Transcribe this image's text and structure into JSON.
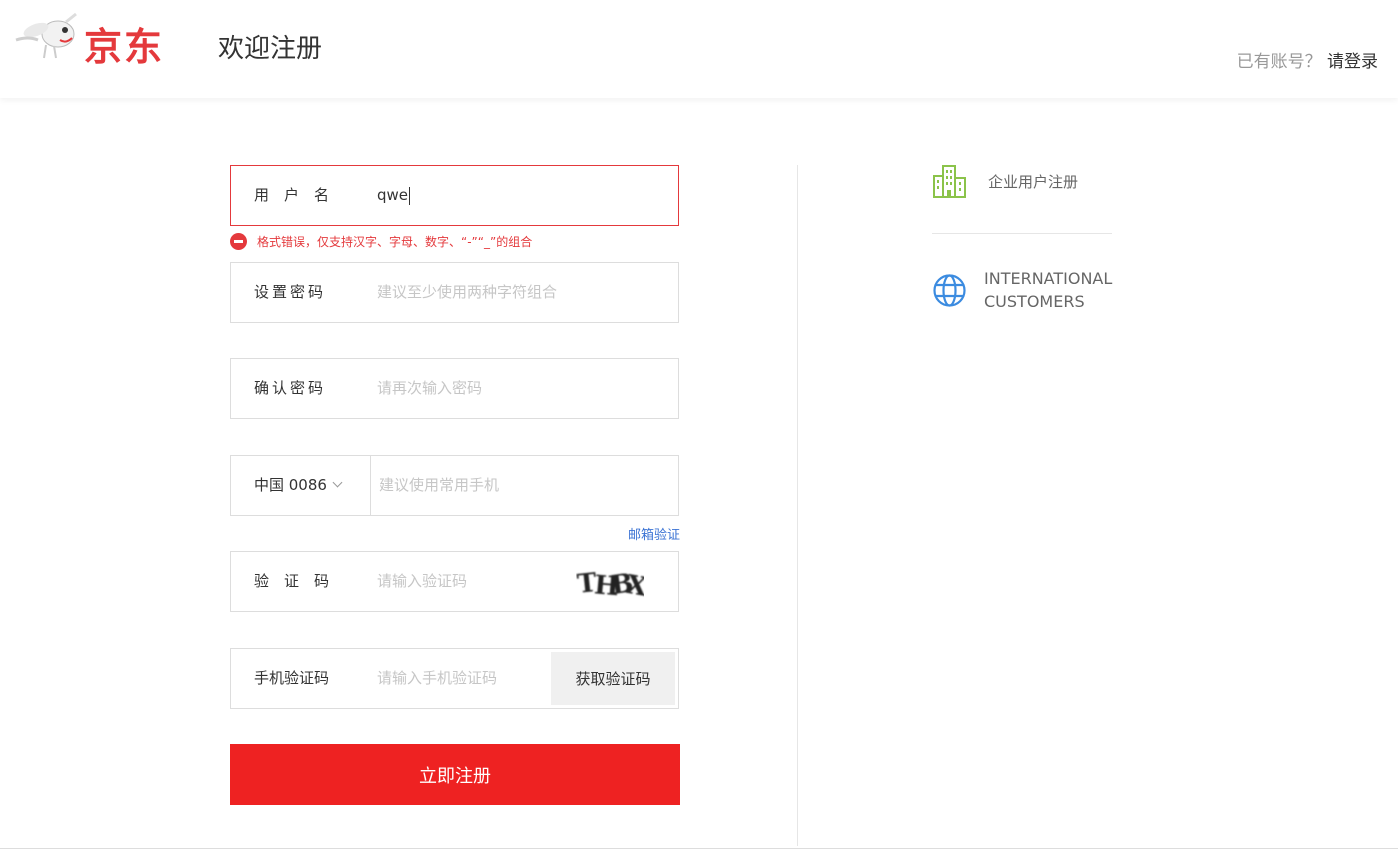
{
  "header": {
    "logo_text": "京东",
    "page_title": "欢迎注册",
    "login_question": "已有账号？",
    "login_link": "请登录"
  },
  "form": {
    "username": {
      "label": "用　户　名",
      "value": "qwe"
    },
    "error_message": "格式错误，仅支持汉字、字母、数字、“-”“_”的组合",
    "password": {
      "label": "设置密码",
      "placeholder": "建议至少使用两种字符组合"
    },
    "confirm_password": {
      "label": "确认密码",
      "placeholder": "请再次输入密码"
    },
    "phone": {
      "country": "中国 0086",
      "placeholder": "建议使用常用手机"
    },
    "email_verify_link": "邮箱验证",
    "captcha": {
      "label": "验　证　码",
      "placeholder": "请输入验证码",
      "image_text": "THBX"
    },
    "sms_code": {
      "label": "手机验证码",
      "placeholder": "请输入手机验证码",
      "button": "获取验证码"
    },
    "submit": "立即注册"
  },
  "side": {
    "enterprise": {
      "label": "企业用户注册",
      "icon": "building-icon"
    },
    "international": {
      "line1": "INTERNATIONAL",
      "line2": "CUSTOMERS",
      "icon": "globe-icon"
    }
  },
  "colors": {
    "brand_red": "#e4393c",
    "submit_red": "#ee2222",
    "link_blue": "#3b73d4",
    "enterprise_green": "#8bc34a",
    "globe_blue": "#3b8be0"
  }
}
